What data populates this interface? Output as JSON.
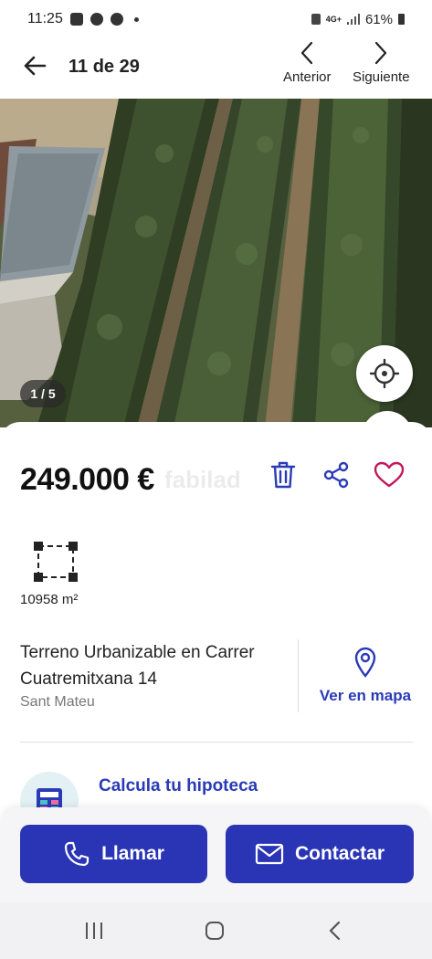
{
  "status_bar": {
    "time": "11:25",
    "network": "4G+",
    "battery": "61%"
  },
  "header": {
    "counter": "11 de 29",
    "prev_label": "Anterior",
    "next_label": "Siguiente"
  },
  "gallery": {
    "counter": "1 / 5"
  },
  "listing": {
    "price": "249.000 €",
    "watermark": "fabilad",
    "area": "10958 m²",
    "address_line1": "Terreno Urbanizable en  Carrer",
    "address_line2": "Cuatremitxana 14",
    "city": "Sant Mateu",
    "map_link": "Ver en mapa"
  },
  "mortgage": {
    "title": "Calcula tu hipoteca"
  },
  "actions": {
    "call_label": "Llamar",
    "contact_label": "Contactar"
  },
  "colors": {
    "accent": "#2a35b5",
    "link": "#2a3bb7",
    "fav": "#c2185b"
  },
  "icons": [
    "back-arrow-icon",
    "chevron-left-icon",
    "chevron-right-icon",
    "locate-icon",
    "trash-icon",
    "share-icon",
    "heart-icon",
    "area-icon",
    "map-pin-icon",
    "calculator-icon",
    "phone-icon",
    "mail-icon"
  ]
}
